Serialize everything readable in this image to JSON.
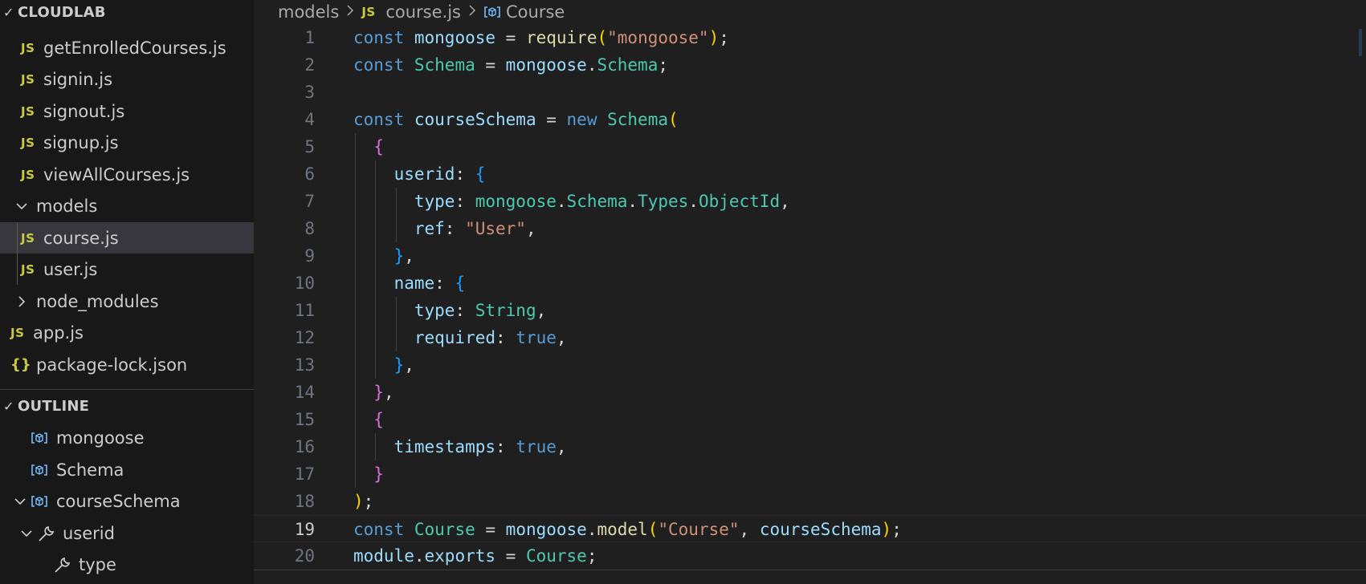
{
  "explorer": {
    "section_title": "CLOUDLAB",
    "items": [
      {
        "label": "getEnrolledCourses.js",
        "kind": "js",
        "icon": "js-file-icon"
      },
      {
        "label": "signin.js",
        "kind": "js",
        "icon": "js-file-icon"
      },
      {
        "label": "signout.js",
        "kind": "js",
        "icon": "js-file-icon"
      },
      {
        "label": "signup.js",
        "kind": "js",
        "icon": "js-file-icon"
      },
      {
        "label": "viewAllCourses.js",
        "kind": "js",
        "icon": "js-file-icon"
      },
      {
        "label": "models",
        "kind": "folder-open",
        "icon": "chevron-down-icon"
      },
      {
        "label": "course.js",
        "kind": "js",
        "icon": "js-file-icon",
        "selected": true
      },
      {
        "label": "user.js",
        "kind": "js",
        "icon": "js-file-icon"
      },
      {
        "label": "node_modules",
        "kind": "folder-closed",
        "icon": "chevron-right-icon"
      },
      {
        "label": "app.js",
        "kind": "js",
        "icon": "js-file-icon"
      },
      {
        "label": "package-lock.json",
        "kind": "json",
        "icon": "json-file-icon"
      }
    ]
  },
  "outline": {
    "section_title": "OUTLINE",
    "items": [
      {
        "label": "mongoose",
        "icon": "variable-symbol-icon"
      },
      {
        "label": "Schema",
        "icon": "variable-symbol-icon"
      },
      {
        "label": "courseSchema",
        "icon": "variable-symbol-icon",
        "expanded": true
      },
      {
        "label": "userid",
        "icon": "property-wrench-icon",
        "expanded": true
      },
      {
        "label": "type",
        "icon": "property-wrench-icon"
      }
    ]
  },
  "breadcrumb": {
    "folder": "models",
    "file": "course.js",
    "file_icon_text": "JS",
    "symbol": "Course"
  },
  "icons": {
    "js_text": "JS",
    "json_text": "{}"
  },
  "editor": {
    "current_line": 19,
    "lines": [
      {
        "n": "1"
      },
      {
        "n": "2"
      },
      {
        "n": "3"
      },
      {
        "n": "4"
      },
      {
        "n": "5"
      },
      {
        "n": "6"
      },
      {
        "n": "7"
      },
      {
        "n": "8"
      },
      {
        "n": "9"
      },
      {
        "n": "10"
      },
      {
        "n": "11"
      },
      {
        "n": "12"
      },
      {
        "n": "13"
      },
      {
        "n": "14"
      },
      {
        "n": "15"
      },
      {
        "n": "16"
      },
      {
        "n": "17"
      },
      {
        "n": "18"
      },
      {
        "n": "19"
      },
      {
        "n": "20"
      }
    ],
    "code": [
      [
        [
          "t-kw",
          "const"
        ],
        [
          "t-pun",
          " "
        ],
        [
          "t-var",
          "mongoose"
        ],
        [
          "t-pun",
          " = "
        ],
        [
          "t-fn",
          "require"
        ],
        [
          "b1",
          "("
        ],
        [
          "t-str",
          "\"mongoose\""
        ],
        [
          "b1",
          ")"
        ],
        [
          "t-pun",
          ";"
        ]
      ],
      [
        [
          "t-kw",
          "const"
        ],
        [
          "t-pun",
          " "
        ],
        [
          "t-cls",
          "Schema"
        ],
        [
          "t-pun",
          " = "
        ],
        [
          "t-var",
          "mongoose"
        ],
        [
          "t-pun",
          "."
        ],
        [
          "t-cls",
          "Schema"
        ],
        [
          "t-pun",
          ";"
        ]
      ],
      [],
      [
        [
          "t-kw",
          "const"
        ],
        [
          "t-pun",
          " "
        ],
        [
          "t-var",
          "courseSchema"
        ],
        [
          "t-pun",
          " = "
        ],
        [
          "t-kw",
          "new"
        ],
        [
          "t-pun",
          " "
        ],
        [
          "t-cls",
          "Schema"
        ],
        [
          "b1",
          "("
        ]
      ],
      [
        [
          "t-pun",
          "  "
        ],
        [
          "b2",
          "{"
        ]
      ],
      [
        [
          "t-pun",
          "    "
        ],
        [
          "t-prop",
          "userid"
        ],
        [
          "t-pun",
          ": "
        ],
        [
          "b3",
          "{"
        ]
      ],
      [
        [
          "t-pun",
          "      "
        ],
        [
          "t-prop",
          "type"
        ],
        [
          "t-pun",
          ": "
        ],
        [
          "t-cls",
          "mongoose"
        ],
        [
          "t-pun",
          "."
        ],
        [
          "t-cls",
          "Schema"
        ],
        [
          "t-pun",
          "."
        ],
        [
          "t-cls",
          "Types"
        ],
        [
          "t-pun",
          "."
        ],
        [
          "t-cls",
          "ObjectId"
        ],
        [
          "t-pun",
          ","
        ]
      ],
      [
        [
          "t-pun",
          "      "
        ],
        [
          "t-prop",
          "ref"
        ],
        [
          "t-pun",
          ": "
        ],
        [
          "t-str",
          "\"User\""
        ],
        [
          "t-pun",
          ","
        ]
      ],
      [
        [
          "t-pun",
          "    "
        ],
        [
          "b3",
          "}"
        ],
        [
          "t-pun",
          ","
        ]
      ],
      [
        [
          "t-pun",
          "    "
        ],
        [
          "t-prop",
          "name"
        ],
        [
          "t-pun",
          ": "
        ],
        [
          "b3",
          "{"
        ]
      ],
      [
        [
          "t-pun",
          "      "
        ],
        [
          "t-prop",
          "type"
        ],
        [
          "t-pun",
          ": "
        ],
        [
          "t-cls",
          "String"
        ],
        [
          "t-pun",
          ","
        ]
      ],
      [
        [
          "t-pun",
          "      "
        ],
        [
          "t-prop",
          "required"
        ],
        [
          "t-pun",
          ": "
        ],
        [
          "t-kw",
          "true"
        ],
        [
          "t-pun",
          ","
        ]
      ],
      [
        [
          "t-pun",
          "    "
        ],
        [
          "b3",
          "}"
        ],
        [
          "t-pun",
          ","
        ]
      ],
      [
        [
          "t-pun",
          "  "
        ],
        [
          "b2",
          "}"
        ],
        [
          "t-pun",
          ","
        ]
      ],
      [
        [
          "t-pun",
          "  "
        ],
        [
          "b2",
          "{"
        ]
      ],
      [
        [
          "t-pun",
          "    "
        ],
        [
          "t-prop",
          "timestamps"
        ],
        [
          "t-pun",
          ": "
        ],
        [
          "t-kw",
          "true"
        ],
        [
          "t-pun",
          ","
        ]
      ],
      [
        [
          "t-pun",
          "  "
        ],
        [
          "b2",
          "}"
        ]
      ],
      [
        [
          "b1",
          ")"
        ],
        [
          "t-pun",
          ";"
        ]
      ],
      [
        [
          "t-kw",
          "const"
        ],
        [
          "t-pun",
          " "
        ],
        [
          "t-cls",
          "Course"
        ],
        [
          "t-pun",
          " = "
        ],
        [
          "t-var",
          "mongoose"
        ],
        [
          "t-pun",
          "."
        ],
        [
          "t-fn",
          "model"
        ],
        [
          "b1",
          "("
        ],
        [
          "t-str",
          "\"Course\""
        ],
        [
          "t-pun",
          ", "
        ],
        [
          "t-var",
          "courseSchema"
        ],
        [
          "b1",
          ")"
        ],
        [
          "t-pun",
          ";"
        ]
      ],
      [
        [
          "t-var",
          "module"
        ],
        [
          "t-pun",
          "."
        ],
        [
          "t-var",
          "exports"
        ],
        [
          "t-pun",
          " = "
        ],
        [
          "t-cls",
          "Course"
        ],
        [
          "t-pun",
          ";"
        ]
      ]
    ]
  }
}
